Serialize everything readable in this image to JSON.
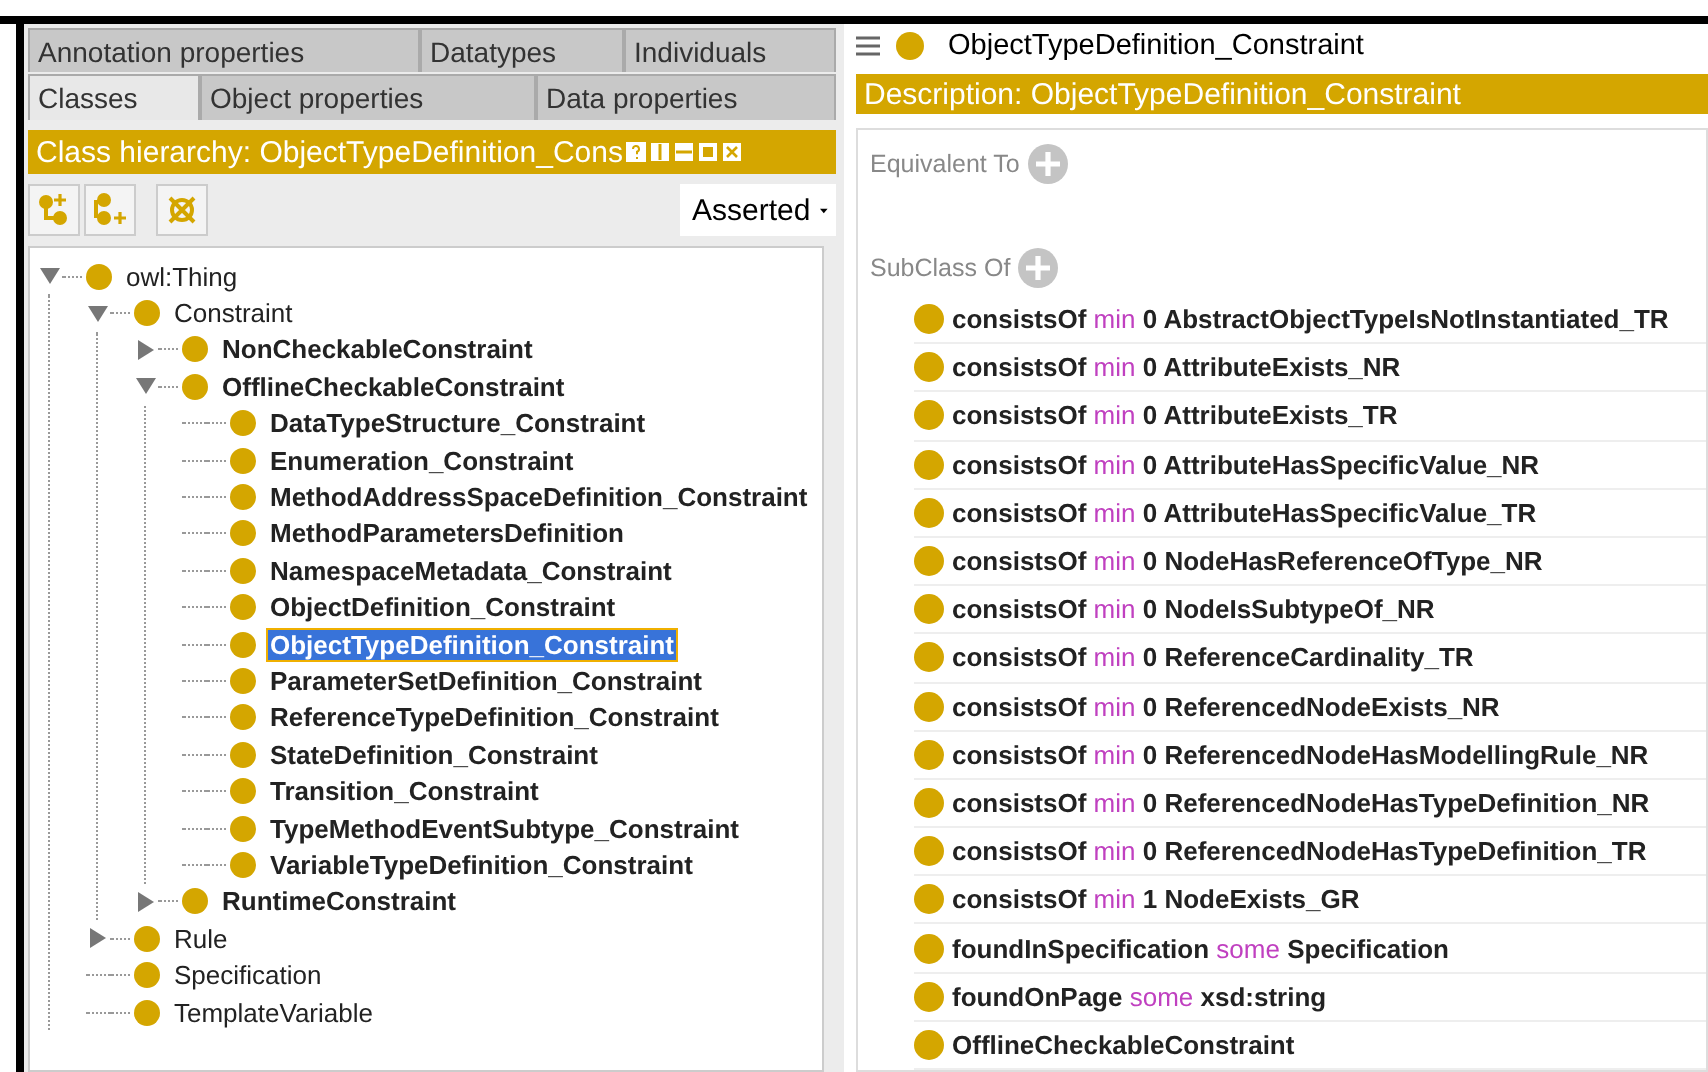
{
  "tabs_row_1": [
    {
      "label": "Annotation properties",
      "selected": false
    },
    {
      "label": "Datatypes",
      "selected": false
    },
    {
      "label": "Individuals",
      "selected": false
    }
  ],
  "tabs_row_2": [
    {
      "label": "Classes",
      "selected": true
    },
    {
      "label": "Object properties",
      "selected": false
    },
    {
      "label": "Data properties",
      "selected": false
    }
  ],
  "hierarchy": {
    "title": "Class hierarchy: ObjectTypeDefinition_Cons",
    "mode": "Asserted",
    "tree": [
      {
        "label": "owl:Thing",
        "kind": "branch",
        "expanded": true,
        "bold": false,
        "selected": false,
        "children": [
          {
            "label": "Constraint",
            "kind": "branch",
            "expanded": true,
            "bold": false,
            "selected": false,
            "children": [
              {
                "label": "NonCheckableConstraint",
                "kind": "branch",
                "expanded": false,
                "bold": true,
                "selected": false
              },
              {
                "label": "OfflineCheckableConstraint",
                "kind": "branch",
                "expanded": true,
                "bold": true,
                "selected": false,
                "children": [
                  {
                    "label": "DataTypeStructure_Constraint",
                    "kind": "leaf",
                    "bold": true,
                    "selected": false
                  },
                  {
                    "label": "Enumeration_Constraint",
                    "kind": "leaf",
                    "bold": true,
                    "selected": false
                  },
                  {
                    "label": "MethodAddressSpaceDefinition_Constraint",
                    "kind": "leaf",
                    "bold": true,
                    "selected": false
                  },
                  {
                    "label": "MethodParametersDefinition",
                    "kind": "leaf",
                    "bold": true,
                    "selected": false
                  },
                  {
                    "label": "NamespaceMetadata_Constraint",
                    "kind": "leaf",
                    "bold": true,
                    "selected": false
                  },
                  {
                    "label": "ObjectDefinition_Constraint",
                    "kind": "leaf",
                    "bold": true,
                    "selected": false
                  },
                  {
                    "label": "ObjectTypeDefinition_Constraint",
                    "kind": "leaf",
                    "bold": true,
                    "selected": true
                  },
                  {
                    "label": "ParameterSetDefinition_Constraint",
                    "kind": "leaf",
                    "bold": true,
                    "selected": false
                  },
                  {
                    "label": "ReferenceTypeDefinition_Constraint",
                    "kind": "leaf",
                    "bold": true,
                    "selected": false
                  },
                  {
                    "label": "StateDefinition_Constraint",
                    "kind": "leaf",
                    "bold": true,
                    "selected": false
                  },
                  {
                    "label": "Transition_Constraint",
                    "kind": "leaf",
                    "bold": true,
                    "selected": false
                  },
                  {
                    "label": "TypeMethodEventSubtype_Constraint",
                    "kind": "leaf",
                    "bold": true,
                    "selected": false
                  },
                  {
                    "label": "VariableTypeDefinition_Constraint",
                    "kind": "leaf",
                    "bold": true,
                    "selected": false
                  }
                ]
              },
              {
                "label": "RuntimeConstraint",
                "kind": "branch",
                "expanded": false,
                "bold": true,
                "selected": false
              }
            ]
          },
          {
            "label": "Rule",
            "kind": "branch",
            "expanded": false,
            "bold": false,
            "selected": false
          },
          {
            "label": "Specification",
            "kind": "leaf",
            "bold": false,
            "selected": false
          },
          {
            "label": "TemplateVariable",
            "kind": "leaf",
            "bold": false,
            "selected": false
          }
        ]
      }
    ]
  },
  "entity": {
    "title": "ObjectTypeDefinition_Constraint"
  },
  "description": {
    "title": "Description: ObjectTypeDefinition_Constraint",
    "sections": [
      {
        "label": "Equivalent To"
      },
      {
        "label": "SubClass Of",
        "entries": [
          {
            "kind": "restriction",
            "property": "consistsOf",
            "keyword": "min",
            "filler": "0 AbstractObjectTypeIsNotInstantiated_TR"
          },
          {
            "kind": "restriction",
            "property": "consistsOf",
            "keyword": "min",
            "filler": "0 AttributeExists_NR"
          },
          {
            "kind": "restriction",
            "property": "consistsOf",
            "keyword": "min",
            "filler": "0 AttributeExists_TR"
          },
          {
            "kind": "restriction",
            "property": "consistsOf",
            "keyword": "min",
            "filler": "0 AttributeHasSpecificValue_NR"
          },
          {
            "kind": "restriction",
            "property": "consistsOf",
            "keyword": "min",
            "filler": "0 AttributeHasSpecificValue_TR"
          },
          {
            "kind": "restriction",
            "property": "consistsOf",
            "keyword": "min",
            "filler": "0 NodeHasReferenceOfType_NR"
          },
          {
            "kind": "restriction",
            "property": "consistsOf",
            "keyword": "min",
            "filler": "0 NodeIsSubtypeOf_NR"
          },
          {
            "kind": "restriction",
            "property": "consistsOf",
            "keyword": "min",
            "filler": "0 ReferenceCardinality_TR"
          },
          {
            "kind": "restriction",
            "property": "consistsOf",
            "keyword": "min",
            "filler": "0 ReferencedNodeExists_NR"
          },
          {
            "kind": "restriction",
            "property": "consistsOf",
            "keyword": "min",
            "filler": "0 ReferencedNodeHasModellingRule_NR"
          },
          {
            "kind": "restriction",
            "property": "consistsOf",
            "keyword": "min",
            "filler": "0 ReferencedNodeHasTypeDefinition_NR"
          },
          {
            "kind": "restriction",
            "property": "consistsOf",
            "keyword": "min",
            "filler": "0 ReferencedNodeHasTypeDefinition_TR"
          },
          {
            "kind": "restriction",
            "property": "consistsOf",
            "keyword": "min",
            "filler": "1 NodeExists_GR"
          },
          {
            "kind": "restriction",
            "property": "foundInSpecification",
            "keyword": "some",
            "filler": "Specification"
          },
          {
            "kind": "restriction",
            "property": "foundOnPage",
            "keyword": "some",
            "filler": "xsd:string"
          },
          {
            "kind": "class",
            "filler": "OfflineCheckableConstraint"
          }
        ]
      }
    ]
  }
}
